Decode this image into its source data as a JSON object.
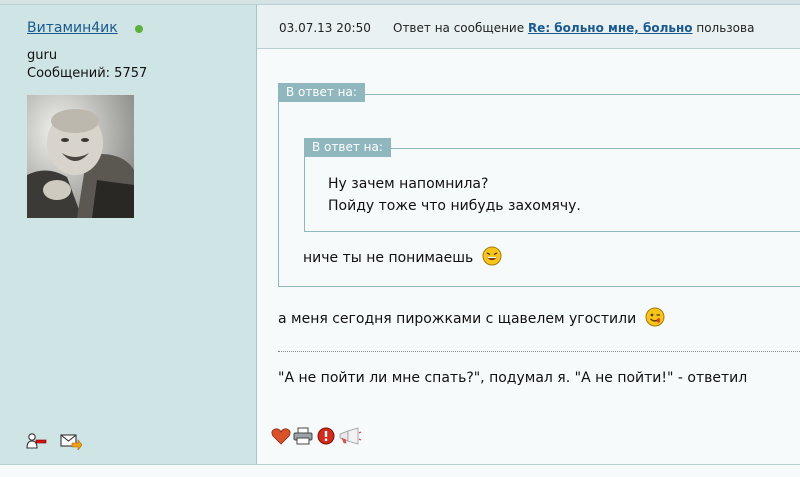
{
  "author": {
    "name": "Витамин4ик",
    "rank": "guru",
    "posts_label": "Сообщений:",
    "posts_count": "5757",
    "online_color": "#5db13d"
  },
  "post": {
    "datetime": "03.07.13 20:50",
    "reply_prefix": "Ответ на сообщение",
    "reply_link": "Re: больно мне, больно",
    "reply_suffix": "пользова"
  },
  "quote_outer": {
    "label": "В ответ на:",
    "inner_quote": {
      "label": "В ответ на:",
      "lines": [
        "Ну зачем напомнила?",
        "Пойду тоже что нибудь захомячу."
      ]
    },
    "text": "ниче ты не понимаешь"
  },
  "body_text": "а меня сегодня пирожками с щавелем угостили",
  "signature": "\"А не пойти ли мне спать?\", подумал я. \"А не пойти!\" - ответил",
  "icons": {
    "profile": "user-profile-icon",
    "message": "send-message-icon",
    "like": "heart-icon",
    "print": "printer-icon",
    "report": "warning-icon",
    "quote": "megaphone-icon"
  },
  "colors": {
    "sidebar_bg": "#cfe4e4",
    "quote_label_bg": "#8fb7bd",
    "link": "#1a5a8e"
  }
}
